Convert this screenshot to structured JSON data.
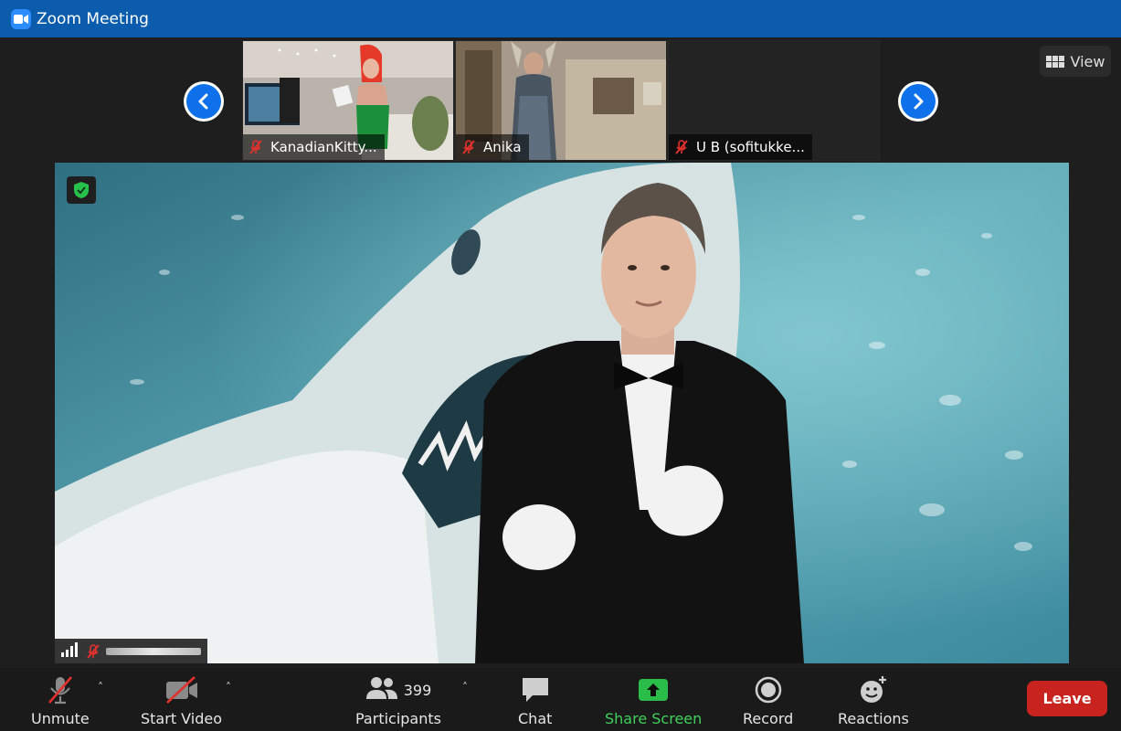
{
  "window": {
    "title": "Zoom Meeting"
  },
  "header": {
    "view_label": "View"
  },
  "participants_strip": [
    {
      "name": "KanadianKitty..."
    },
    {
      "name": "Anika"
    },
    {
      "name": "U B (sofitukke..."
    }
  ],
  "toolbar": {
    "unmute": "Unmute",
    "start_video": "Start Video",
    "participants": "Participants",
    "participant_count": "399",
    "chat": "Chat",
    "share_screen": "Share Screen",
    "record": "Record",
    "reactions": "Reactions",
    "leave": "Leave"
  },
  "colors": {
    "title_bar": "#0b5cad",
    "share_green": "#3fd15a",
    "leave_red": "#c8231f",
    "nav_blue": "#0e71eb",
    "mute_red": "#e0312d"
  }
}
